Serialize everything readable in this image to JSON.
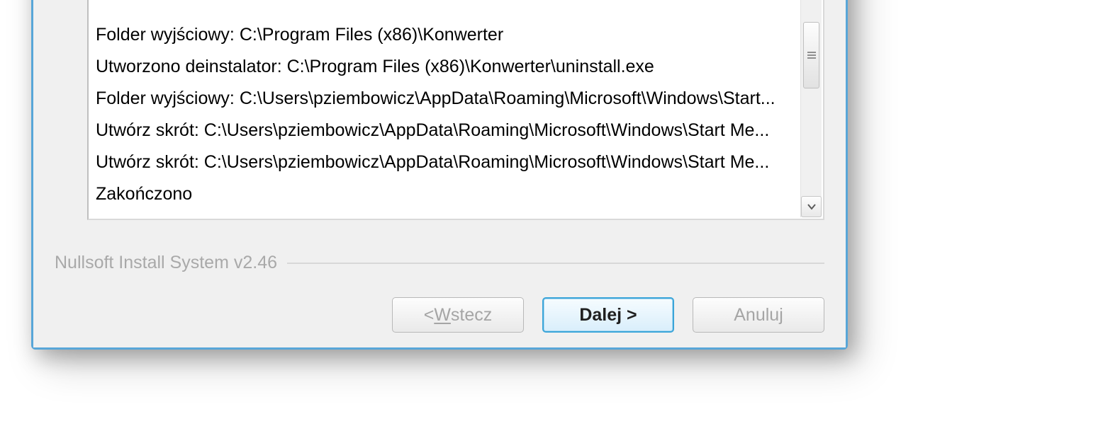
{
  "log": {
    "lines": [
      "Folder wyjściowy: C:\\Program Files (x86)\\Konwerter",
      "Utworzono deinstalator: C:\\Program Files (x86)\\Konwerter\\uninstall.exe",
      "Folder wyjściowy: C:\\Users\\pziembowicz\\AppData\\Roaming\\Microsoft\\Windows\\Start...",
      "Utwórz skrót: C:\\Users\\pziembowicz\\AppData\\Roaming\\Microsoft\\Windows\\Start Me...",
      "Utwórz skrót: C:\\Users\\pziembowicz\\AppData\\Roaming\\Microsoft\\Windows\\Start Me...",
      "Zakończono"
    ]
  },
  "footer": {
    "brand": "Nullsoft Install System v2.46"
  },
  "buttons": {
    "back_prefix": "< ",
    "back_accel": "W",
    "back_suffix": "stecz",
    "next": "Dalej >",
    "cancel": "Anuluj"
  }
}
